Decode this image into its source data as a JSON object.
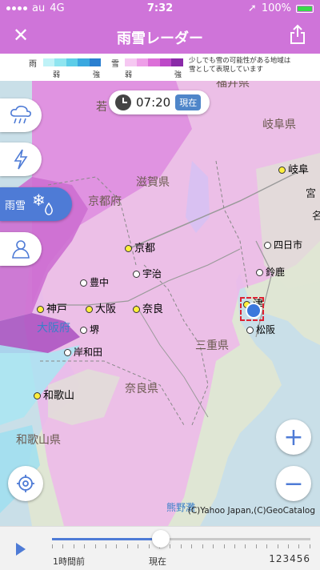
{
  "status": {
    "carrier": "au",
    "network": "4G",
    "time": "7:32",
    "battery": "100%"
  },
  "nav": {
    "title": "雨雪レーダー",
    "close_glyph": "✕"
  },
  "legend": {
    "rain_label": "雨",
    "snow_label": "雪",
    "weak": "弱",
    "strong": "強",
    "note_line1": "少しでも雪の可能性がある地域は",
    "note_line2": "雪として表現しています",
    "rain_colors": [
      "#bff2f7",
      "#8fe5f0",
      "#5dcde8",
      "#3aa8e0",
      "#2a7fd0"
    ],
    "snow_colors": [
      "#f6c8f2",
      "#ee9fe8",
      "#dc6fd8",
      "#bd48c8",
      "#8a2aa8"
    ]
  },
  "time_pill": {
    "time": "07:20",
    "now_label": "現在"
  },
  "side_buttons": {
    "active_label": "雨雪",
    "snow_glyph": "❄"
  },
  "map_places": [
    {
      "label": "京都"
    },
    {
      "label": "宇治"
    },
    {
      "label": "豊中"
    },
    {
      "label": "神戸"
    },
    {
      "label": "大阪"
    },
    {
      "label": "奈良"
    },
    {
      "label": "堺"
    },
    {
      "label": "岸和田"
    },
    {
      "label": "和歌山"
    },
    {
      "label": "岐阜"
    },
    {
      "label": "四日市"
    },
    {
      "label": "鈴鹿"
    },
    {
      "label": "津"
    },
    {
      "label": "松阪"
    }
  ],
  "map_regions": {
    "fukui": "福井県",
    "gifu": "岐阜県",
    "shiga": "滋賀県",
    "kyotofu": "京都府",
    "osakafu": "大阪府",
    "mie": "三重県",
    "nara": "奈良県",
    "wakayama": "和歌山県",
    "wakasa": "若",
    "kumano": "熊野灘",
    "miya": "宮",
    "cut": "名"
  },
  "zoom": {
    "in": "+",
    "out": "−"
  },
  "copyright": "(C)Yahoo Japan,(C)GeoCatalog",
  "timeline": {
    "label_1h": "1時間前",
    "label_now": "現在",
    "page_numbers": "123456",
    "progress": 0.42
  }
}
